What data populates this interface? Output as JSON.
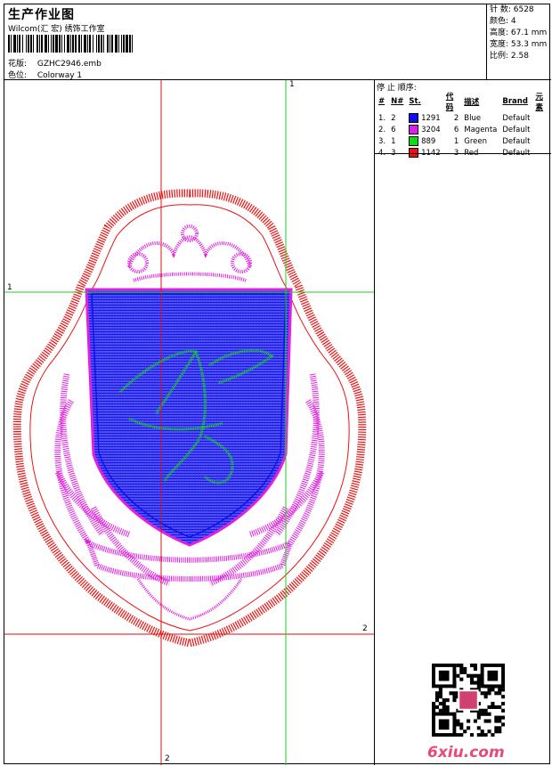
{
  "header": {
    "title": "生产作业图",
    "company": "Wilcom(汇 宏) 绣饰工作室",
    "design_label": "花版:",
    "design_value": "GZHC2946.emb",
    "colorway_label": "色位:",
    "colorway_value": "Colorway 1"
  },
  "stats": {
    "stitches": "针 数: 6528",
    "colors": "颜色: 4",
    "height": "高度: 67.1 mm",
    "width": "宽度: 53.3 mm",
    "ratio": "比例: 2.58"
  },
  "stop_sequence": {
    "title": "停 止 顺序:",
    "headers": [
      "#",
      "N#",
      "St.",
      "代码",
      "描述",
      "Brand",
      "元素"
    ],
    "rows": [
      {
        "idx": "1.",
        "n": "2",
        "code": "1291",
        "num": "2",
        "desc": "Blue",
        "brand": "Default",
        "color": "#1010ee"
      },
      {
        "idx": "2.",
        "n": "6",
        "code": "3204",
        "num": "6",
        "desc": "Magenta",
        "brand": "Default",
        "color": "#e020e0"
      },
      {
        "idx": "3.",
        "n": "1",
        "code": "889",
        "num": "1",
        "desc": "Green",
        "brand": "Default",
        "color": "#10dd10"
      },
      {
        "idx": "4.",
        "n": "3",
        "code": "1142",
        "num": "3",
        "desc": "Red",
        "brand": "Default",
        "color": "#ee1010"
      }
    ]
  },
  "canvas": {
    "guide_labels": {
      "top_1": "1",
      "left_1": "1",
      "right_2": "2",
      "bottom_2": "2"
    },
    "colors": {
      "red": "#ee1010",
      "magenta": "#e020e0",
      "blue": "#1010ee",
      "green": "#10dd10",
      "guide_green": "#22cc22",
      "guide_red": "#dd1111"
    }
  },
  "watermark": {
    "text": "6xiu.com"
  }
}
